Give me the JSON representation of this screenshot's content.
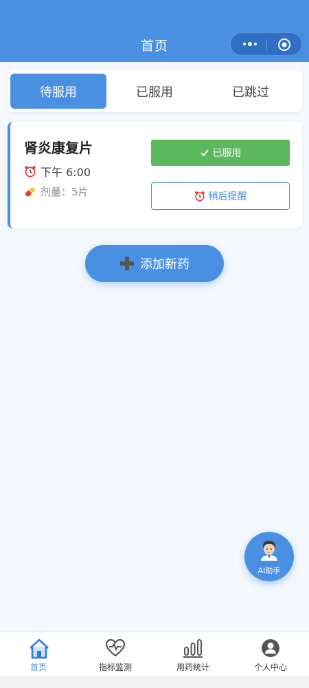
{
  "header": {
    "title": "首页"
  },
  "tabs": [
    {
      "label": "待服用",
      "active": true
    },
    {
      "label": "已服用",
      "active": false
    },
    {
      "label": "已跳过",
      "active": false
    }
  ],
  "medication": {
    "name": "肾炎康复片",
    "time": "下午 6:00",
    "dose": "剂量：5片",
    "taken_label": "已服用",
    "remind_label": "稍后提醒"
  },
  "add_button": {
    "label": "添加新药"
  },
  "ai_assistant": {
    "label": "AI助手"
  },
  "bottom_nav": [
    {
      "label": "首页",
      "icon": "home-icon",
      "active": true
    },
    {
      "label": "指标监测",
      "icon": "heart-monitor-icon",
      "active": false
    },
    {
      "label": "用药统计",
      "icon": "bar-chart-icon",
      "active": false
    },
    {
      "label": "个人中心",
      "icon": "user-icon",
      "active": false
    }
  ],
  "colors": {
    "primary": "#4a90e2",
    "success": "#5cb85c",
    "background": "#f4f7fb"
  }
}
